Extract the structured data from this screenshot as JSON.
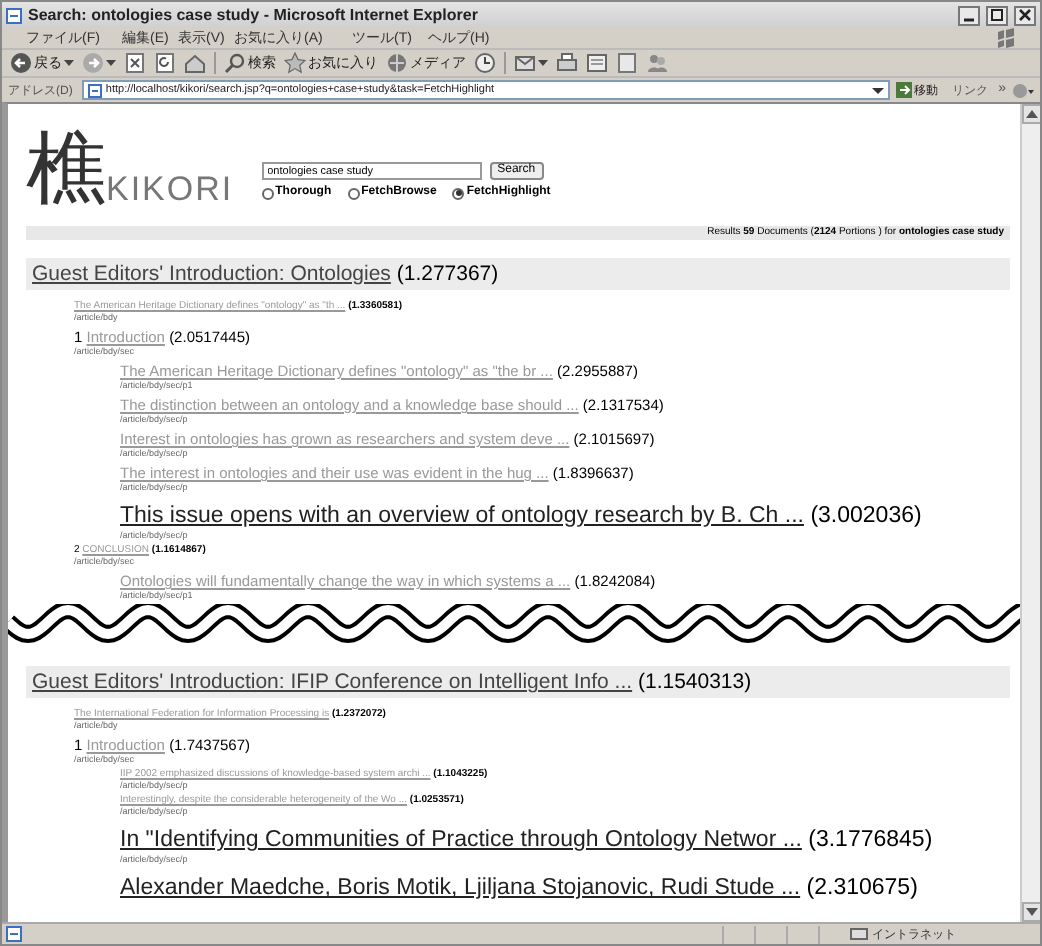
{
  "window": {
    "title": "Search: ontologies case study - Microsoft Internet Explorer"
  },
  "menu": [
    "ファイル(F)",
    "編集(E)",
    "表示(V)",
    "お気に入り(A)",
    "ツール(T)",
    "ヘルプ(H)"
  ],
  "toolbar_labels": [
    "戻る",
    "検索",
    "お気に入り",
    "メディア"
  ],
  "address": {
    "label": "アドレス(D)",
    "url": "http://localhost/kikori/search.jsp?q=ontologies+case+study&task=FetchHighlight",
    "go": "移動",
    "links": "リンク",
    "more": "»"
  },
  "logo": {
    "kanji": "樵",
    "text": "KIKORI"
  },
  "search": {
    "value": "ontologies case study",
    "button": "Search"
  },
  "modes": [
    {
      "label": "Thorough",
      "selected": false
    },
    {
      "label": "FetchBrowse",
      "selected": false
    },
    {
      "label": "FetchHighlight",
      "selected": true
    }
  ],
  "results_summary": "Results **59** Documents (**2124** Portions ) for **ontologies case study**",
  "groups": [
    {
      "title": "Guest Editors' Introduction: Ontologies",
      "score": "(1.277367)",
      "children": [
        {
          "kind": "small",
          "text": "The American Heritage Dictionary defines \"ontology\" as \"th ...",
          "score": "(1.3360581)",
          "path": "/article/bdy"
        },
        {
          "kind": "medium",
          "number": "1",
          "text": "Introduction",
          "score": "(2.0517445)",
          "path": "/article/bdy/sec",
          "children": [
            {
              "kind": "medium",
              "text": "The American Heritage Dictionary defines \"ontology\" as \"the br ...",
              "score": "(2.2955887)",
              "path": "/article/bdy/sec/p1"
            },
            {
              "kind": "medium",
              "text": "The distinction between an ontology and a knowledge base should ...",
              "score": "(2.1317534)",
              "path": "/article/bdy/sec/p"
            },
            {
              "kind": "medium",
              "text": "Interest in ontologies has grown as researchers and system deve ...",
              "score": "(2.1015697)",
              "path": "/article/bdy/sec/p"
            },
            {
              "kind": "medium",
              "text": "The interest in ontologies and their use was evident in the hug ...",
              "score": "(1.8396637)",
              "path": "/article/bdy/sec/p"
            },
            {
              "kind": "large",
              "text": "This issue opens with an overview of ontology research by B. Ch ...",
              "score": "(3.002036)",
              "path": "/article/bdy/sec/p"
            }
          ]
        },
        {
          "kind": "small",
          "number": "2",
          "text": "CONCLUSION",
          "score": "(1.1614867)",
          "path": "/article/bdy/sec",
          "children": [
            {
              "kind": "medium",
              "text": "Ontologies will fundamentally change the way in which systems a ...",
              "score": "(1.8242084)",
              "path": "/article/bdy/sec/p1"
            }
          ]
        }
      ]
    },
    {
      "title": "Guest Editors' Introduction: IFIP Conference on Intelligent Info ...",
      "score": "(1.1540313)",
      "children": [
        {
          "kind": "small",
          "text": "The International Federation for Information Processing is",
          "score": "(1.2372072)",
          "path": "/article/bdy"
        },
        {
          "kind": "medium",
          "number": "1",
          "text": "Introduction",
          "score": "(1.7437567)",
          "path": "/article/bdy/sec",
          "children": [
            {
              "kind": "small",
              "text": "IIP 2002 emphasized discussions of knowledge-based system archi ...",
              "score": "(1.1043225)",
              "path": "/article/bdy/sec/p"
            },
            {
              "kind": "small",
              "text": "Interestingly, despite the considerable heterogeneity of the Wo ...",
              "score": "(1.0253571)",
              "path": "/article/bdy/sec/p"
            },
            {
              "kind": "large",
              "text": "In \"Identifying Communities of Practice through Ontology Networ ...",
              "score": "(3.1776845)",
              "path": "/article/bdy/sec/p"
            },
            {
              "kind": "large",
              "text": "Alexander Maedche, Boris Motik, Ljiljana Stojanovic, Rudi Stude ...",
              "score": "(2.310675)"
            }
          ]
        }
      ]
    }
  ],
  "status": {
    "zone": "イントラネット"
  }
}
